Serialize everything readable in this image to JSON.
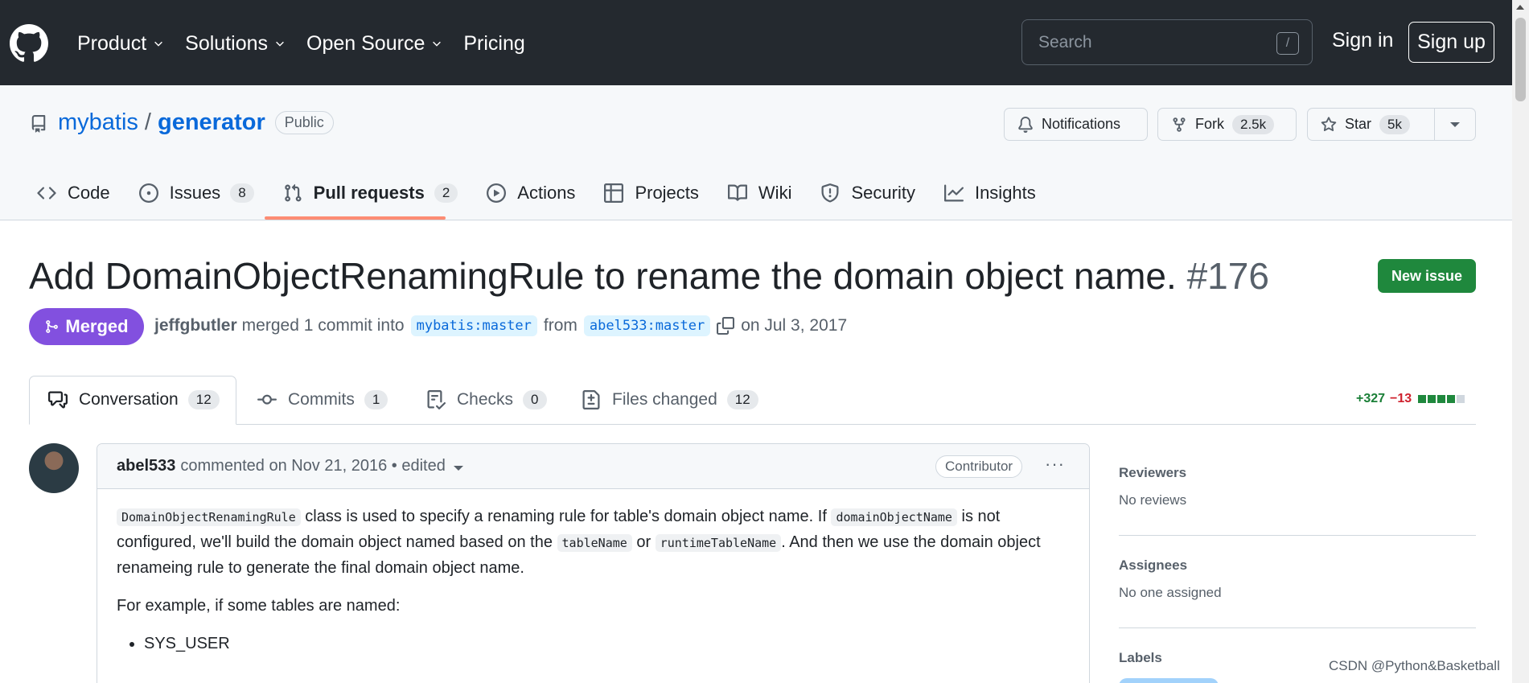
{
  "topbar": {
    "nav": [
      {
        "label": "Product",
        "dropdown": true
      },
      {
        "label": "Solutions",
        "dropdown": true
      },
      {
        "label": "Open Source",
        "dropdown": true
      },
      {
        "label": "Pricing",
        "dropdown": false
      }
    ],
    "search_placeholder": "Search",
    "search_shortcut": "/",
    "signin": "Sign in",
    "signup": "Sign up"
  },
  "repo": {
    "owner": "mybatis",
    "separator": "/",
    "name": "generator",
    "visibility": "Public",
    "notifications": "Notifications",
    "fork": {
      "label": "Fork",
      "count": "2.5k"
    },
    "star": {
      "label": "Star",
      "count": "5k"
    }
  },
  "tabs": [
    {
      "label": "Code",
      "count": null
    },
    {
      "label": "Issues",
      "count": "8"
    },
    {
      "label": "Pull requests",
      "count": "2"
    },
    {
      "label": "Actions",
      "count": null
    },
    {
      "label": "Projects",
      "count": null
    },
    {
      "label": "Wiki",
      "count": null
    },
    {
      "label": "Security",
      "count": null
    },
    {
      "label": "Insights",
      "count": null
    }
  ],
  "pr": {
    "title": "Add DomainObjectRenamingRule to rename the domain object name.",
    "number": "#176",
    "new_issue": "New issue",
    "state": "Merged",
    "author": "jeffgbutler",
    "merged_text": "merged 1 commit into",
    "base_branch": "mybatis:master",
    "from_text": "from",
    "head_branch": "abel533:master",
    "date_text": "on Jul 3, 2017"
  },
  "pr_tabs": [
    {
      "label": "Conversation",
      "count": "12"
    },
    {
      "label": "Commits",
      "count": "1"
    },
    {
      "label": "Checks",
      "count": "0"
    },
    {
      "label": "Files changed",
      "count": "12"
    }
  ],
  "diffstat": {
    "additions": "+327",
    "deletions": "−13"
  },
  "colors": {
    "merged": "#8250df",
    "new_issue": "#1f883d",
    "tab_underline": "#fd8c73",
    "add": "#1a7f37",
    "del": "#cf222e"
  },
  "comment": {
    "author": "abel533",
    "meta": "commented on Nov 21, 2016 • edited",
    "role": "Contributor",
    "menu": "···",
    "p1": [
      {
        "code": "DomainObjectRenamingRule"
      },
      {
        "text": " class is used to specify a renaming rule for table's domain object name. If "
      },
      {
        "code": "domainObjectName"
      },
      {
        "text": " is not configured, we'll build the domain object named based on the "
      },
      {
        "code": "tableName"
      },
      {
        "text": " or "
      },
      {
        "code": "runtimeTableName"
      },
      {
        "text": ". And then we use the domain object renameing rule to generate the final domain object name."
      }
    ],
    "p2": "For example, if some tables are named:",
    "list": [
      "SYS_USER"
    ]
  },
  "sidebar": {
    "reviewers_h": "Reviewers",
    "reviewers_v": "No reviews",
    "assignees_h": "Assignees",
    "assignees_v": "No one assigned",
    "labels_h": "Labels"
  },
  "watermark": "CSDN @Python&Basketball"
}
